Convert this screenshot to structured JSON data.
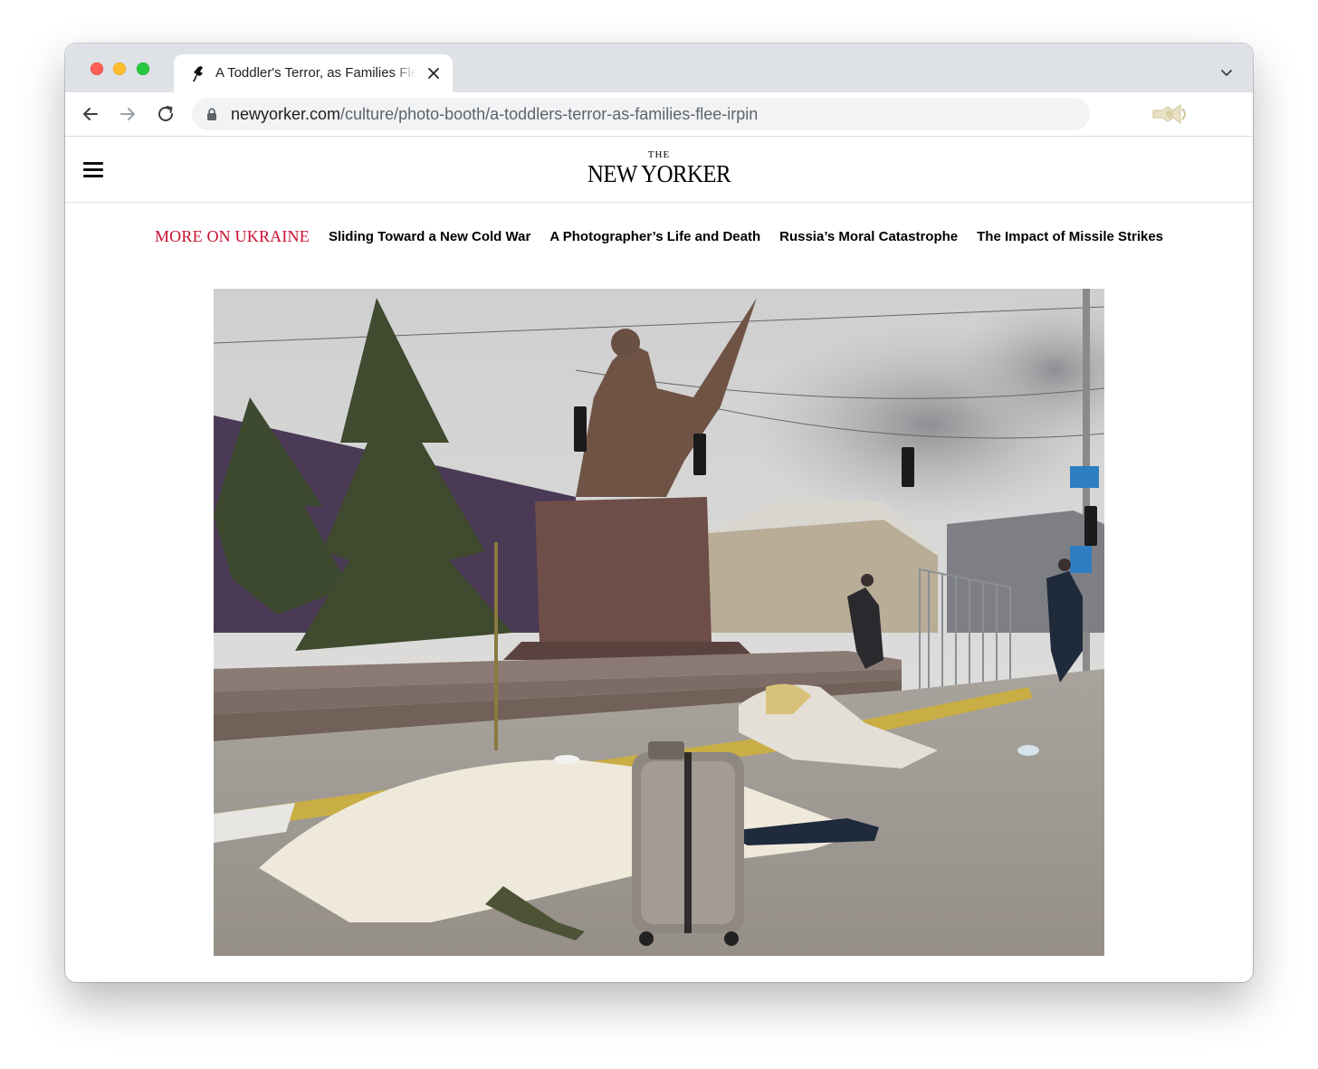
{
  "browser": {
    "tab": {
      "title": "A Toddler's Terror, as Families Flee Irpin"
    },
    "url": {
      "host": "newyorker.com",
      "path": "/culture/photo-booth/a-toddlers-terror-as-families-flee-irpin"
    }
  },
  "site": {
    "logo_small": "THE",
    "logo_big": "NEW YORKER"
  },
  "topic_nav": {
    "label": "MORE ON UKRAINE",
    "links": [
      "Sliding Toward a New Cold War",
      "A Photographer’s Life and Death",
      "Russia’s Moral Catastrophe",
      "The Impact of Missile Strikes"
    ]
  },
  "icons": {
    "back": "arrow-left-icon",
    "forward": "arrow-right-icon",
    "reload": "reload-icon",
    "lock": "lock-icon",
    "tab_close": "close-icon",
    "tab_list": "chevron-down-icon",
    "menu": "hamburger-menu-icon",
    "extension": "extension-icon"
  },
  "colors": {
    "accent": "#c8102e",
    "tabstrip": "#dee1e6",
    "omnibox": "#f1f3f4"
  }
}
